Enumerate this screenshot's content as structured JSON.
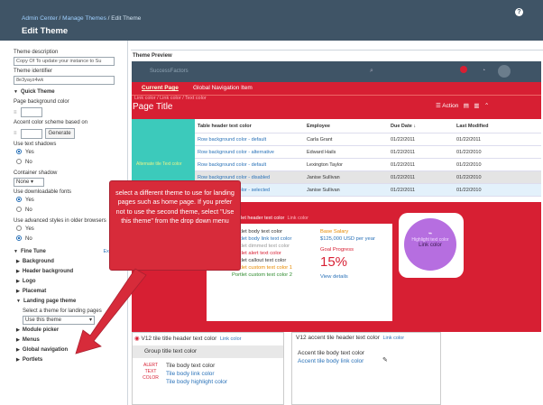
{
  "header": {
    "crumb1": "Admin Center",
    "crumb2": "Manage Themes",
    "crumb3": "Edit Theme",
    "title": "Edit Theme",
    "help": "?"
  },
  "left": {
    "theme_desc_label": "Theme description",
    "theme_desc_value": "Copy Of To update your instance to Su",
    "theme_id_label": "Theme identifier",
    "theme_id_value": "8e3yayz4wk",
    "quick_theme": "Quick Theme",
    "page_bg_label": "Page background color",
    "accent_label": "Accent color scheme based on",
    "generate": "Generate",
    "shadows_label": "Use text shadows",
    "yes": "Yes",
    "no": "No",
    "container_shadow_label": "Container shadow",
    "none": "None",
    "downloadable_fonts_label": "Use downloadable fonts",
    "advanced_styles_label": "Use advanced styles in older browsers",
    "fine_tune": "Fine Tune",
    "expand": "Expa",
    "items": [
      "Background",
      "Header background",
      "Logo",
      "Placemat"
    ],
    "landing": "Landing page theme",
    "landing_select_label": "Select a theme for landing pages",
    "landing_select_value": "Use this theme",
    "more": [
      "Module picker",
      "Menus",
      "Global navigation",
      "Portlets"
    ]
  },
  "preview": {
    "label": "Theme Preview",
    "logo": "SuccessFactors",
    "current_page": "Current Page",
    "global_nav": "Global Navigation Item",
    "links": "Link color / Link color / Text color",
    "page_title": "Page Title",
    "action": "Action",
    "tile_text": "Alternate tile Text color",
    "table": {
      "headers": [
        "Table header text color",
        "Employee",
        "Due Date",
        "Last Modified"
      ],
      "rows": [
        [
          "Row background color - default",
          "Carla Grant",
          "01/22/2011",
          "01/22/2011"
        ],
        [
          "Row background color - alternative",
          "Edward Hails",
          "01/22/2011",
          "01/22/2010"
        ],
        [
          "Row background color - default",
          "Lexington Taylor",
          "01/22/2011",
          "01/22/2010"
        ],
        [
          "Row background color - disabled",
          "Janise Sullivan",
          "01/22/2011",
          "01/22/2010"
        ],
        [
          "Row background color - selected",
          "Janise Sullivan",
          "01/22/2011",
          "01/22/2010"
        ]
      ]
    },
    "portlet": {
      "header": "Portlet header text color",
      "header_link": "Link color",
      "lines": [
        "Portlet body text color",
        "Portlet body link text color",
        "Portlet dimmed text color",
        "Portlet alert text color",
        "Portlet callout text color",
        "Portlet custom text color 1",
        "Portlet custom text color 2"
      ],
      "base_salary": "Base Salary",
      "salary": "$125,000",
      "per_year": "USD per year",
      "goal": "Goal Progress",
      "pct": "15%",
      "view": "View details"
    },
    "circle": {
      "hl": "Highlight text color",
      "link": "Link color"
    },
    "v12": {
      "title": "V12 tile title header text color",
      "link": "Link color",
      "group": "Group title text color",
      "alert": "ALERT TEXT COLOR",
      "body": "Tile body text color",
      "body_link": "Tile body link color",
      "highlight": "Tile body highlight color"
    },
    "v12a": {
      "title": "V12 accent tile header text color",
      "link": "Link color",
      "body": "Accent tile body text color",
      "body_link": "Accent tile body link color"
    }
  },
  "callout": "select a different theme to use for landing pages such as home page. If you prefer not to use the second theme, select \"Use this theme\" from the drop down menu",
  "colors": {
    "brand_red": "#d71f33",
    "teal": "#3ccabb",
    "shell": "#3f5466",
    "purple": "#b66ee0"
  }
}
